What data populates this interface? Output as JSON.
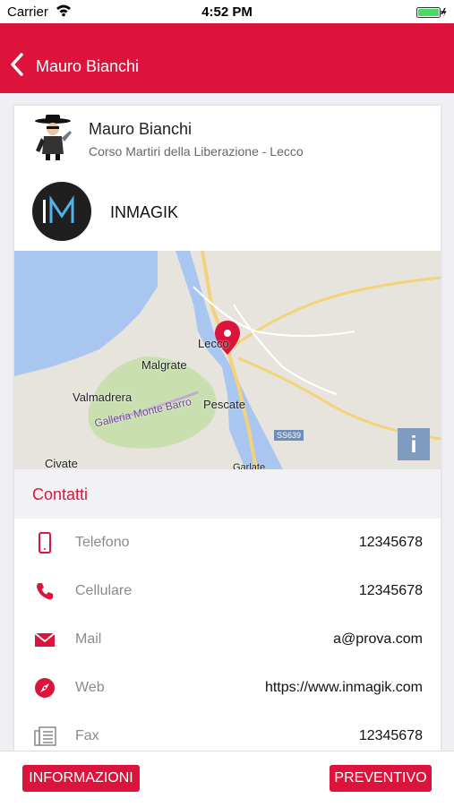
{
  "status_bar": {
    "carrier": "Carrier",
    "time": "4:52 PM"
  },
  "nav": {
    "title": "Mauro Bianchi",
    "back_icon": "chevron-left-icon"
  },
  "person": {
    "name": "Mauro Bianchi",
    "address": "Corso Martiri della Liberazione - Lecco"
  },
  "company": {
    "logo_text": "IM",
    "name": "INMAGIK"
  },
  "map": {
    "labels": {
      "lecco": "Lecco",
      "malgrate": "Malgrate",
      "valmadrera": "Valmadrera",
      "galleria": "Galleria Monte Barro",
      "pescate": "Pescate",
      "civate": "Civate",
      "road": "SS639",
      "garlate": "Garlate"
    },
    "info_label": "i"
  },
  "contacts": {
    "header": "Contatti",
    "rows": [
      {
        "icon": "phone-icon",
        "label": "Telefono",
        "value": "12345678"
      },
      {
        "icon": "handset-icon",
        "label": "Cellulare",
        "value": "12345678"
      },
      {
        "icon": "mail-icon",
        "label": "Mail",
        "value": "a@prova.com"
      },
      {
        "icon": "compass-icon",
        "label": "Web",
        "value": "https://www.inmagik.com"
      },
      {
        "icon": "fax-icon",
        "label": "Fax",
        "value": "12345678"
      }
    ]
  },
  "footer": {
    "info_button": "INFORMAZIONI",
    "quote_button": "PREVENTIVO"
  },
  "colors": {
    "brand": "#dc143c",
    "map_info": "#7f9bbd"
  }
}
